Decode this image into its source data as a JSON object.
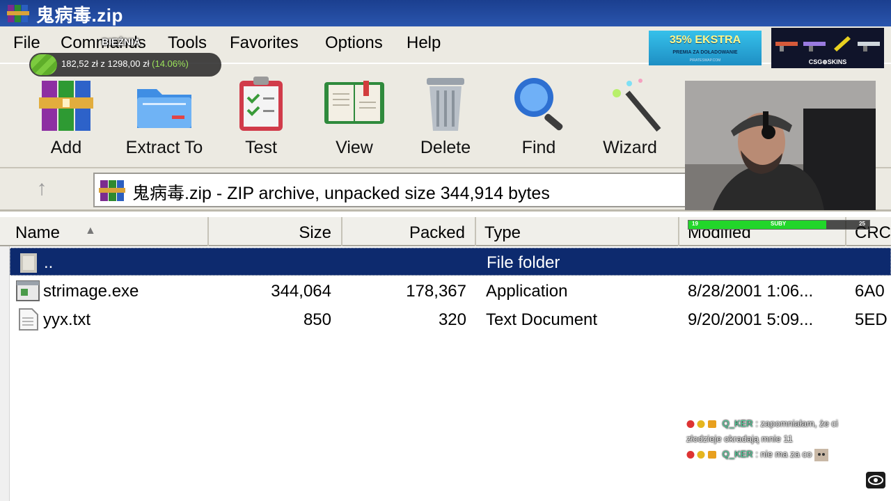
{
  "window": {
    "title": "鬼病毒.zip"
  },
  "menu": [
    "File",
    "Commands",
    "Tools",
    "Favorites",
    "Options",
    "Help"
  ],
  "toolbar": [
    {
      "label": "Add",
      "icon": "add-books-icon"
    },
    {
      "label": "Extract To",
      "icon": "folder-icon"
    },
    {
      "label": "Test",
      "icon": "clipboard-check-icon"
    },
    {
      "label": "View",
      "icon": "open-book-icon"
    },
    {
      "label": "Delete",
      "icon": "trash-icon"
    },
    {
      "label": "Find",
      "icon": "magnifier-icon"
    },
    {
      "label": "Wizard",
      "icon": "magic-wand-icon"
    }
  ],
  "address": {
    "text": "鬼病毒.zip - ZIP archive, unpacked size 344,914 bytes"
  },
  "columns": [
    "Name",
    "Size",
    "Packed",
    "Type",
    "Modified",
    "CRC"
  ],
  "rows": [
    {
      "name": "..",
      "size": "",
      "packed": "",
      "type": "File folder",
      "modified": "",
      "crc": "",
      "selected": true
    },
    {
      "name": "strimage.exe",
      "size": "344,064",
      "packed": "178,367",
      "type": "Application",
      "modified": "8/28/2001 1:06...",
      "crc": "6A0"
    },
    {
      "name": "yyx.txt",
      "size": "850",
      "packed": "320",
      "type": "Text Document",
      "modified": "9/20/2001 5:09...",
      "crc": "5ED"
    }
  ],
  "overlay": {
    "goal_label": "BIEŻNIA",
    "progress_current": "182,52 zł",
    "progress_sep": "z",
    "progress_total": "1298,00 zł",
    "progress_percent": "(14.06%)",
    "progress_fraction": 0.1406,
    "ad_headline": "35% EKSTRA",
    "ad_sub": "PREMIA ZA DOŁADOWANIE",
    "ad_foot": "PIRATESWAP.COM",
    "skins_label": "CSG⊕SKINS",
    "subs_label": "SUBY",
    "subs_min": "19",
    "subs_max": "25",
    "subs_fraction": 0.76
  },
  "chat": [
    {
      "user": "Q_KER",
      "message": "zapomniałam, że ci złodzieje okradają mnie 11"
    },
    {
      "user": "Q_KER",
      "message": "nie ma za co"
    }
  ],
  "colors": {
    "selection": "#0d2a6e",
    "titlebar": "#1b3f8f",
    "toolbar_bg": "#eceae2",
    "chat_user": "#4fd19b"
  }
}
